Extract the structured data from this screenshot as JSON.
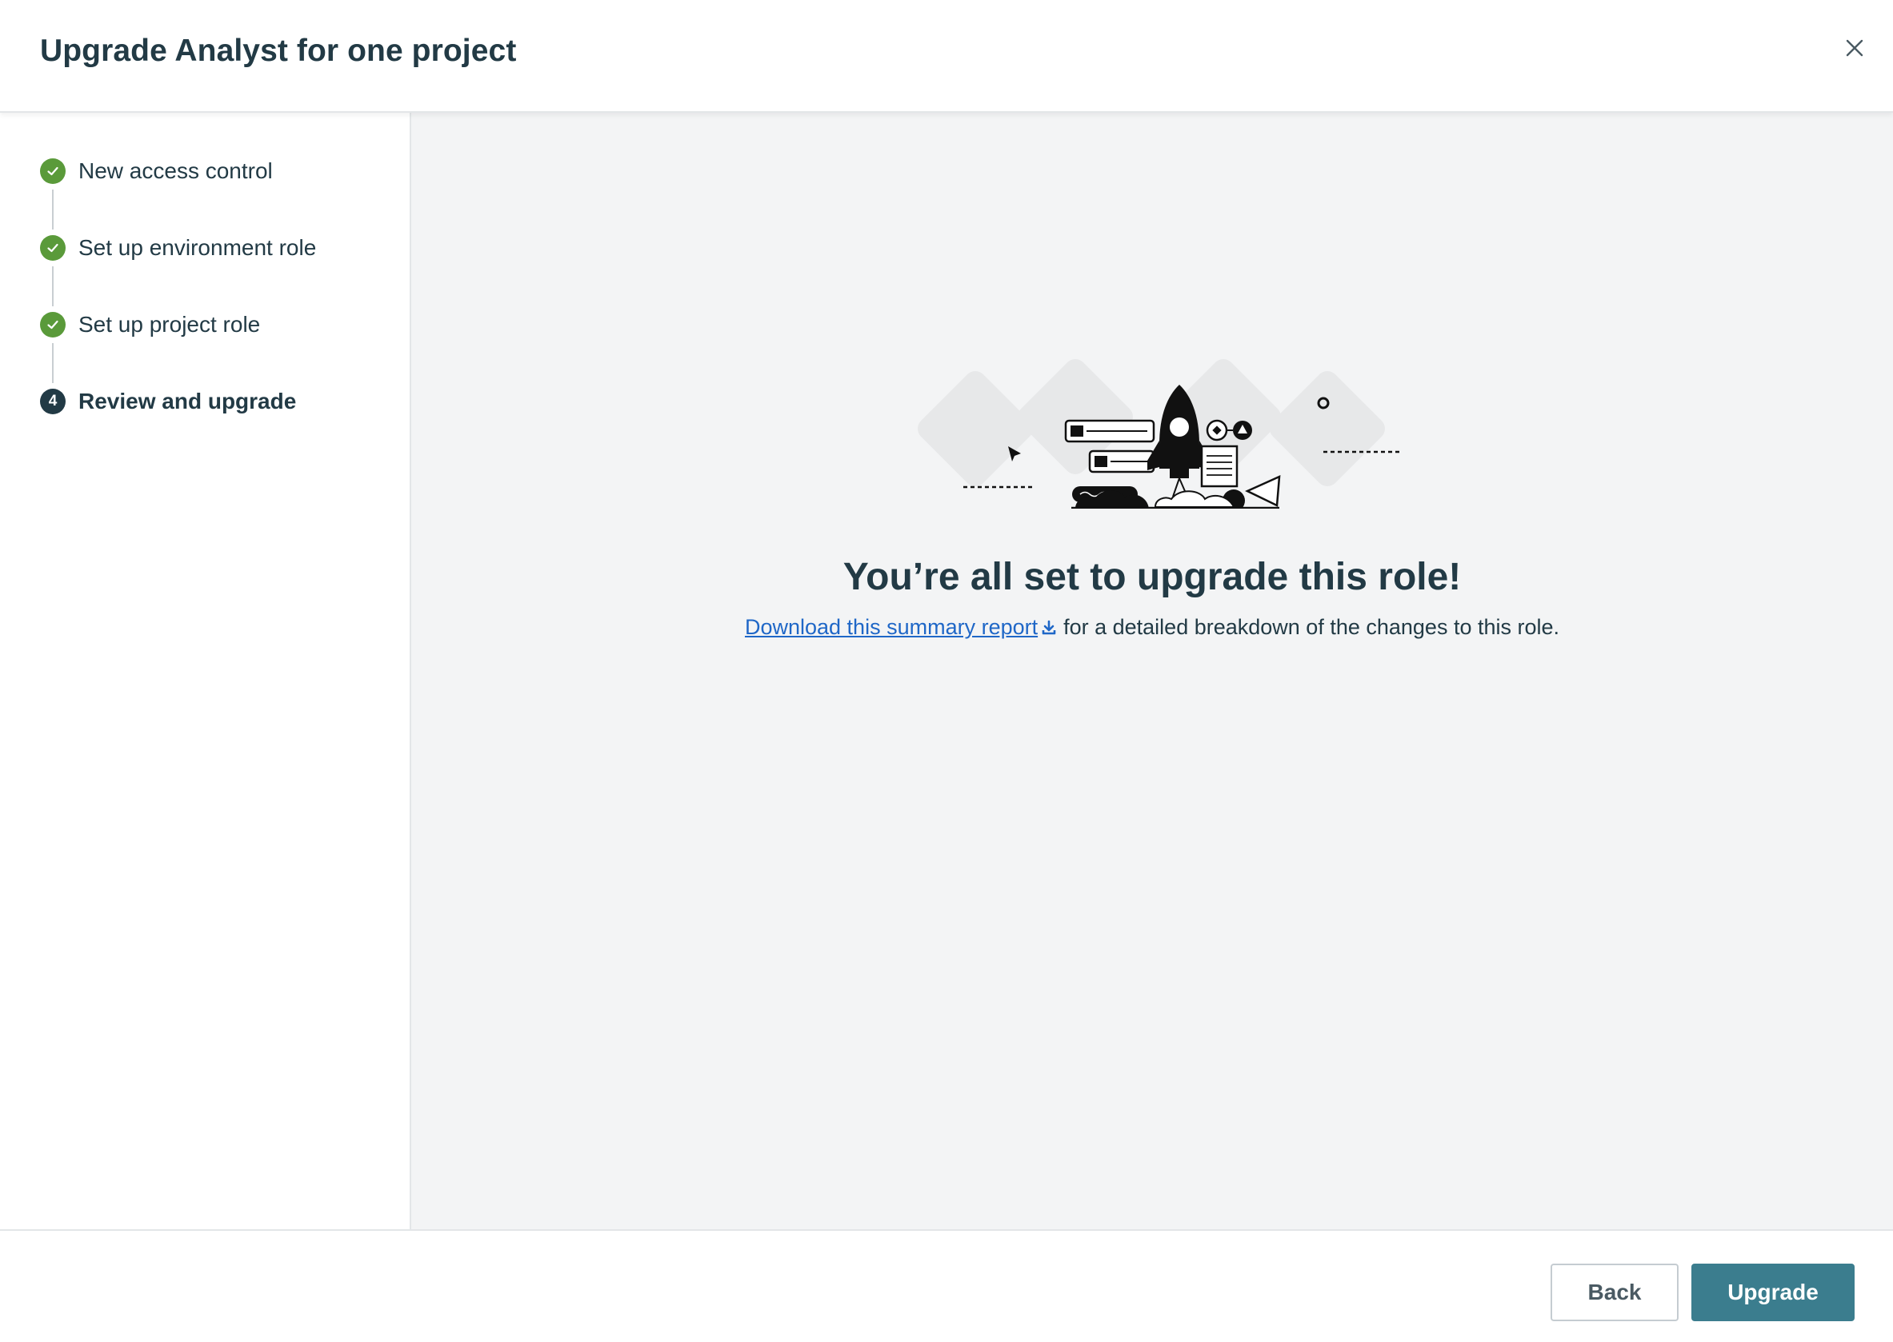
{
  "header": {
    "title": "Upgrade Analyst for one project",
    "close_icon": "close-icon"
  },
  "stepper": {
    "steps": [
      {
        "label": "New access control",
        "status": "complete"
      },
      {
        "label": "Set up environment role",
        "status": "complete"
      },
      {
        "label": "Set up project role",
        "status": "complete"
      },
      {
        "label": "Review and upgrade",
        "status": "current",
        "number": "4"
      }
    ]
  },
  "main": {
    "illustration": "rocket-launch-illustration",
    "headline": "You’re all set to upgrade this role!",
    "download_link": "Download this summary report",
    "download_icon": "download-icon",
    "description_suffix": "for a detailed breakdown of the changes to this role."
  },
  "footer": {
    "back_label": "Back",
    "upgrade_label": "Upgrade"
  },
  "colors": {
    "complete": "#5a9a3a",
    "current": "#223a45",
    "primary_button": "#3b7d8e",
    "link": "#1f67c7"
  }
}
